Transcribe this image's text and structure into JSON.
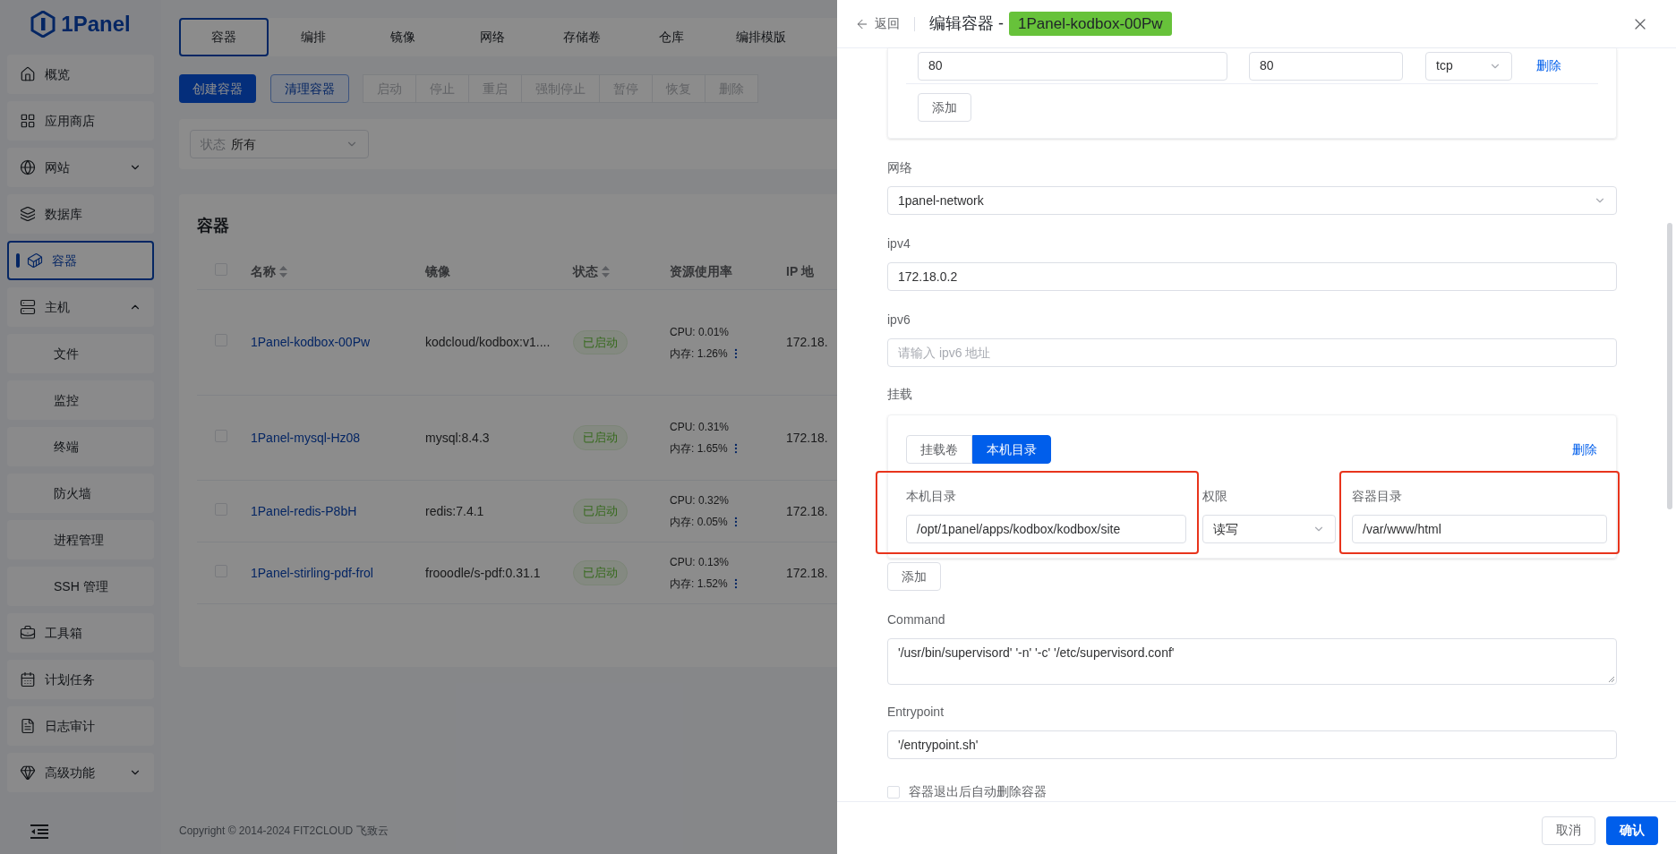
{
  "sidebar": {
    "logo": "1Panel",
    "items": [
      {
        "label": "概览",
        "selected": false
      },
      {
        "label": "应用商店",
        "selected": false
      },
      {
        "label": "网站",
        "selected": false,
        "expanded": false
      },
      {
        "label": "数据库",
        "selected": false
      },
      {
        "label": "容器",
        "selected": true
      },
      {
        "label": "主机",
        "selected": false,
        "expanded": true,
        "children": [
          {
            "label": "文件",
            "selected": false
          },
          {
            "label": "监控",
            "selected": false
          },
          {
            "label": "终端",
            "selected": false
          },
          {
            "label": "防火墙",
            "selected": false
          },
          {
            "label": "进程管理",
            "selected": false
          },
          {
            "label": "SSH 管理",
            "selected": false
          }
        ]
      },
      {
        "label": "工具箱",
        "selected": false
      },
      {
        "label": "计划任务",
        "selected": false
      },
      {
        "label": "日志审计",
        "selected": false
      },
      {
        "label": "高级功能",
        "selected": false,
        "expanded": false
      }
    ]
  },
  "tabs": [
    {
      "label": "容器",
      "selected": true
    },
    {
      "label": "编排",
      "selected": false
    },
    {
      "label": "镜像",
      "selected": false
    },
    {
      "label": "网络",
      "selected": false
    },
    {
      "label": "存储卷",
      "selected": false
    },
    {
      "label": "仓库",
      "selected": false
    },
    {
      "label": "编排模版",
      "selected": false
    }
  ],
  "toolbar": {
    "create_button": "创建容器",
    "clean_button": "清理容器",
    "batch_buttons": [
      {
        "label": "启动",
        "disabled": true
      },
      {
        "label": "停止",
        "disabled": true
      },
      {
        "label": "重启",
        "disabled": true
      },
      {
        "label": "强制停止",
        "disabled": true
      },
      {
        "label": "暂停",
        "disabled": true
      },
      {
        "label": "恢复",
        "disabled": true
      },
      {
        "label": "删除",
        "disabled": true
      }
    ]
  },
  "filter": {
    "label": "状态",
    "value": "所有"
  },
  "table": {
    "title": "容器",
    "select_all_checked": false,
    "columns": [
      {
        "label": "名称",
        "sortable": true
      },
      {
        "label": "镜像",
        "sortable": false
      },
      {
        "label": "状态",
        "sortable": true
      },
      {
        "label": "资源使用率",
        "sortable": false
      },
      {
        "label": "IP 地",
        "sortable": false
      }
    ],
    "rows": [
      {
        "checked": false,
        "name": "1Panel-kodbox-00Pw",
        "image": "kodcloud/kodbox:v1....",
        "status": "已启动",
        "cpu": "CPU: 0.01%",
        "memory": "内存: 1.26%",
        "ip": "172.18."
      },
      {
        "checked": false,
        "name": "1Panel-mysql-Hz08",
        "image": "mysql:8.4.3",
        "status": "已启动",
        "cpu": "CPU: 0.31%",
        "memory": "内存: 1.65%",
        "ip": "172.18."
      },
      {
        "checked": false,
        "name": "1Panel-redis-P8bH",
        "image": "redis:7.4.1",
        "status": "已启动",
        "cpu": "CPU: 0.32%",
        "memory": "内存: 0.05%",
        "ip": "172.18."
      },
      {
        "checked": false,
        "name": "1Panel-stirling-pdf-frol",
        "image": "frooodle/s-pdf:0.31.1",
        "status": "已启动",
        "cpu": "CPU: 0.13%",
        "memory": "内存: 1.52%",
        "ip": "172.18."
      }
    ]
  },
  "footer": "Copyright © 2014-2024 FIT2CLOUD 飞致云",
  "drawer": {
    "back": "返回",
    "title": "编辑容器 -",
    "name_tag": "1Panel-kodbox-00Pw",
    "ports": {
      "rows": [
        {
          "host_port": "80",
          "container_port": "80",
          "protocol": "tcp",
          "delete": "删除"
        }
      ],
      "add_button": "添加"
    },
    "network": {
      "label": "网络",
      "value": "1panel-network"
    },
    "ipv4": {
      "label": "ipv4",
      "value": "172.18.0.2"
    },
    "ipv6": {
      "label": "ipv6",
      "placeholder": "请输入 ipv6 地址"
    },
    "mounts": {
      "label": "挂载",
      "tabs": [
        {
          "label": "挂载卷",
          "selected": false
        },
        {
          "label": "本机目录",
          "selected": true
        }
      ],
      "delete": "删除",
      "fields": [
        {
          "kind": "input",
          "label": "本机目录",
          "value": "/opt/1panel/apps/kodbox/kodbox/site",
          "highlighted": true
        },
        {
          "kind": "select",
          "label": "权限",
          "value": "读写",
          "highlighted": false
        },
        {
          "kind": "input",
          "label": "容器目录",
          "value": "/var/www/html",
          "highlighted": true
        }
      ],
      "add_button": "添加"
    },
    "command": {
      "label": "Command",
      "value": "'/usr/bin/supervisord' '-n' '-c' '/etc/supervisord.conf'"
    },
    "entrypoint": {
      "label": "Entrypoint",
      "value": "'/entrypoint.sh'"
    },
    "auto_remove": {
      "label": "容器退出后自动删除容器",
      "checked": false
    },
    "cancel_button": "取消",
    "confirm_button": "确认"
  }
}
